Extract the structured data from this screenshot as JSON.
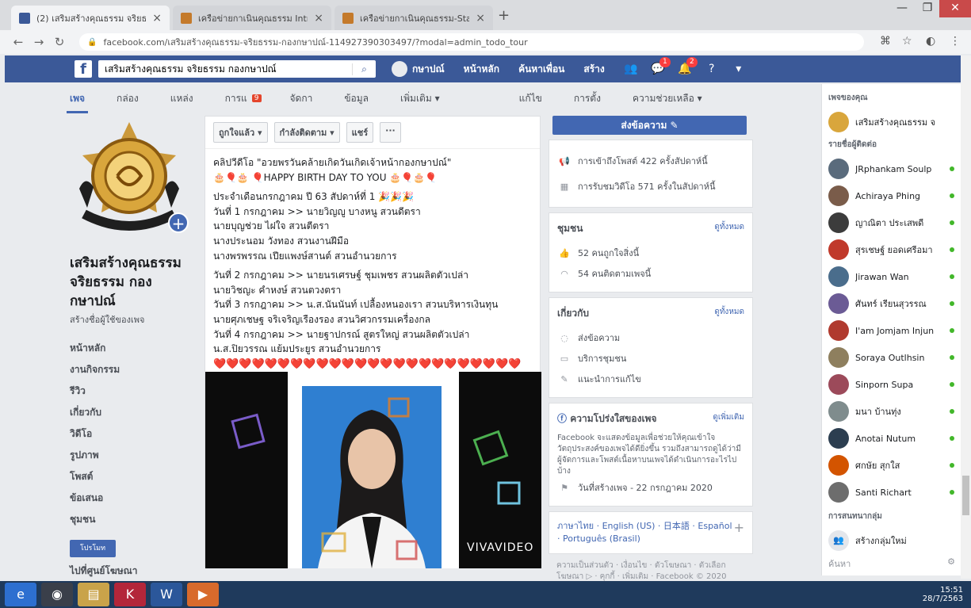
{
  "browser": {
    "tabs": [
      {
        "title": "(2) เสริมสร้างคุณธรรม จริยธรรม กอง",
        "favicon_color": "#3b5998",
        "active": true
      },
      {
        "title": "เครือข่ายกาเนินคุณธรรม Intrane",
        "favicon_color": "#c47a2b",
        "active": false
      },
      {
        "title": "เครือข่ายกาเนินคุณธรรม-Staff Bo",
        "favicon_color": "#c47a2b",
        "active": false
      }
    ],
    "new_tab": "+",
    "window": {
      "minimize": "—",
      "maximize": "❐",
      "close": "✕"
    },
    "url": "facebook.com/เสริมสร้างคุณธรรม-จริยธรรม-กองกษาปณ์-114927390303497/?modal=admin_todo_tour"
  },
  "fb": {
    "search_value": "เสริมสร้างคุณธรรม จริยธรรม กองกษาปณ์",
    "nav": {
      "profile": "กษาปณ์",
      "home": "หน้าหลัก",
      "find_friends": "ค้นหาเพื่อน",
      "create": "สร้าง"
    },
    "badges": {
      "messages": "1",
      "notifications": "2"
    }
  },
  "page_tabs": [
    {
      "label": "เพจ",
      "active": true
    },
    {
      "label": "กล่อง",
      "active": false
    },
    {
      "label": "แหล่ง",
      "active": false
    },
    {
      "label": "การแ",
      "active": false
    },
    {
      "label": "จัดกา",
      "active": false
    },
    {
      "label": "ข้อมูล",
      "active": false
    },
    {
      "label": "เพิ่มเติม ▾",
      "active": false
    }
  ],
  "page_tabs_badge": "9",
  "page_tabs_right": [
    {
      "label": "แก้ไข"
    },
    {
      "label": "การตั้ง"
    },
    {
      "label": "ความช่วยเหลือ ▾"
    }
  ],
  "page": {
    "name": "เสริมสร้างคุณธรรม จริยธรรม กองกษาปณ์",
    "handle": "สร้างชื่อผู้ใช้ของเพจ",
    "nav": [
      "หน้าหลัก",
      "งานกิจกรรม",
      "รีวิว",
      "เกี่ยวกับ",
      "วิดีโอ",
      "รูปภาพ",
      "โพสต์",
      "ข้อเสนอ",
      "ชุมชน"
    ],
    "promote": "โปรโมท",
    "ad_center": "ไปที่ศูนย์โฆษณา"
  },
  "post": {
    "actions": [
      "ถูกใจแล้ว ▾",
      "กำลังติดตาม ▾",
      "แชร์",
      "···"
    ],
    "lines": [
      "คลิปวีดีโอ \"อวยพรวันคล้ายเกิดวันเกิดเจ้าหน้ากองกษาปณ์\"",
      "🎂🎈🎂 🎈HAPPY BIRTH DAY TO YOU 🎂🎈🎂🎈",
      "",
      "ประจำเดือนกรกฎาคม ปี 63 สัปดาห์ที่ 1 🎉🎉🎉",
      "วันที่ 1 กรกฎาคม >> นายวิญญู บางหนู สวนดีตรา",
      "นายบุญช่วย ไฝใจ สวนตีตรา",
      "นางประนอม วังทอง สวนงานฝีมือ",
      "นางพรพรรณ เปียแพงษ์สานต์ สวนอำนวยการ",
      "",
      "วันที่ 2 กรกฎาคม >> นายนรเศรษฐ์ ชุมเพชร สวนผลิตตัวเปล่า",
      "นายวิชญะ คำหงษ์ สวนตวงตรา",
      "วันที่ 3 กรกฎาคม >> น.ส.นันนันท์ เปลื้องหนองเรา สวนบริหารเงินทุน",
      "นายศุภเชษฐ จริเจริญเรืองรอง สวนวิศวกรรมเครื่องกล",
      "วันที่ 4 กรกฎาคม >> นายฐาปกรณ์ สูตรใหญ่ สวนผลิตตัวเปล่า",
      "น.ส.ปิยวรรณ แย้มประยูร สวนอำนวยการ"
    ],
    "hearts": "❤️❤️❤️❤️❤️❤️❤️❤️❤️❤️❤️❤️❤️❤️❤️❤️❤️❤️❤️❤️❤️❤️❤️❤️",
    "watermark": "VIVAVIDEO"
  },
  "mid": {
    "send_message": "ส่งข้อความ ✎",
    "stats": [
      {
        "icon": "megaphone-icon",
        "text": "การเข้าถึงโพสต์ 422 ครั้งสัปดาห์นี้"
      },
      {
        "icon": "calendar-icon",
        "text": "การรับชมวิดีโอ 571 ครั้งในสัปดาห์นี้"
      }
    ],
    "community": {
      "title": "ชุมชน",
      "see_all": "ดูทั้งหมด",
      "likes": "52 คนถูกใจสิ่งนี้",
      "follows": "54 คนติดตามเพจนี้"
    },
    "about": {
      "title": "เกี่ยวกับ",
      "see_all": "ดูทั้งหมด",
      "items": [
        "ส่งข้อความ",
        "บริการชุมชน",
        "แนะนำการแก้ไข"
      ]
    },
    "transparency": {
      "title": "ความโปร่งใสของเพจ",
      "link": "ดูเพิ่มเติม",
      "desc": "Facebook จะแสดงข้อมูลเพื่อช่วยให้คุณเข้าใจวัตถุประสงค์ของเพจได้ดียิ่งขึ้น รวมถึงสามารถดูได้ว่ามีผู้จัดการและโพสต์เนื้อหาบนเพจได้ดำเนินการอะไรไปบ้าง",
      "created": "วันที่สร้างเพจ - 22 กรกฎาคม 2020"
    },
    "languages": "ภาษาไทย · English (US) · 日本語 · Español · Português (Brasil)",
    "lang_add": "+",
    "footer": "ความเป็นส่วนตัว · เงื่อนไข · ตัวโฆษณา · ตัวเลือกโฆษณา ▷ · คุกกี้ · เพิ่มเติม · Facebook © 2020"
  },
  "right": {
    "your_pages": "เพจของคุณ",
    "page_entry": "เสริมสร้างคุณธรรม จ",
    "contacts_title": "รายชื่อผู้ติดต่อ",
    "contacts": [
      {
        "name": "JRphankam Soulp",
        "color": "#5a6b7c"
      },
      {
        "name": "Achiraya Phing",
        "color": "#7a5c4a"
      },
      {
        "name": "ญาณิตา ประเสพดี",
        "color": "#3c3c3c"
      },
      {
        "name": "สุรเชษฐ์ ยอดเศรีอมา",
        "color": "#c0392b"
      },
      {
        "name": "Jirawan Wan",
        "color": "#4a6d8c"
      },
      {
        "name": "ศันทร์ เรียนสุวรรณ",
        "color": "#6b5b95"
      },
      {
        "name": "I'am Jomjam Injun",
        "color": "#b03a2e"
      },
      {
        "name": "Soraya Outlhsin",
        "color": "#8e7f5e"
      },
      {
        "name": "Sinporn Supa",
        "color": "#9c4a5a"
      },
      {
        "name": "มนา บ้านทุ่ง",
        "color": "#7f8c8d"
      },
      {
        "name": "Anotai Nutum",
        "color": "#2c3e50"
      },
      {
        "name": "ศกษัย สุกใส",
        "color": "#d35400"
      },
      {
        "name": "Santi Richart",
        "color": "#6d6d6d"
      }
    ],
    "groups_title": "การสนทนากลุ่ม",
    "create_group": "สร้างกลุ่มใหม่",
    "search": "ค้นหา"
  },
  "taskbar": {
    "time": "15:51",
    "date": "28/7/2563"
  }
}
